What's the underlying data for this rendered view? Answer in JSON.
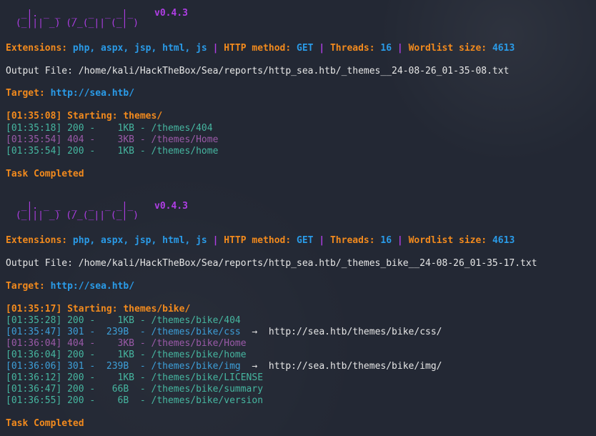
{
  "runs": [
    {
      "logo": "  _|. _ _  _  _  _ _|_\n (_||| _) (/_(_|| (_| )",
      "version": "v0.4.3",
      "config": {
        "extensions_label": "Extensions:",
        "extensions": "php, aspx, jsp, html, js",
        "sep": "|",
        "method_label": "HTTP method:",
        "method": "GET",
        "threads_label": "Threads:",
        "threads": "16",
        "wordlist_label": "Wordlist size:",
        "wordlist": "4613"
      },
      "output_file": "Output File: /home/kali/HackTheBox/Sea/reports/http_sea.htb/_themes__24-08-26_01-35-08.txt",
      "target_label": "Target:",
      "target": "http://sea.htb/",
      "starting": "[01:35:08] Starting: themes/",
      "results": [
        {
          "text": "[01:35:18] 200 -    1KB - /themes/404",
          "kind": "ok",
          "redirect": ""
        },
        {
          "text": "[01:35:54] 404 -    3KB - /themes/Home",
          "kind": "notfound",
          "redirect": ""
        },
        {
          "text": "[01:35:54] 200 -    1KB - /themes/home",
          "kind": "ok",
          "redirect": ""
        }
      ],
      "completed": "Task Completed"
    },
    {
      "logo": "  _|. _ _  _  _  _ _|_\n (_||| _) (/_(_|| (_| )",
      "version": "v0.4.3",
      "config": {
        "extensions_label": "Extensions:",
        "extensions": "php, aspx, jsp, html, js",
        "sep": "|",
        "method_label": "HTTP method:",
        "method": "GET",
        "threads_label": "Threads:",
        "threads": "16",
        "wordlist_label": "Wordlist size:",
        "wordlist": "4613"
      },
      "output_file": "Output File: /home/kali/HackTheBox/Sea/reports/http_sea.htb/_themes_bike__24-08-26_01-35-17.txt",
      "target_label": "Target:",
      "target": "http://sea.htb/",
      "starting": "[01:35:17] Starting: themes/bike/",
      "results": [
        {
          "text": "[01:35:28] 200 -    1KB - /themes/bike/404",
          "kind": "ok",
          "redirect": ""
        },
        {
          "text": "[01:35:47] 301 -  239B  - /themes/bike/css",
          "kind": "redirect",
          "redirect": "http://sea.htb/themes/bike/css/"
        },
        {
          "text": "[01:36:04] 404 -    3KB - /themes/bike/Home",
          "kind": "notfound",
          "redirect": ""
        },
        {
          "text": "[01:36:04] 200 -    1KB - /themes/bike/home",
          "kind": "ok",
          "redirect": ""
        },
        {
          "text": "[01:36:06] 301 -  239B  - /themes/bike/img",
          "kind": "redirect",
          "redirect": "http://sea.htb/themes/bike/img/"
        },
        {
          "text": "[01:36:12] 200 -    1KB - /themes/bike/LICENSE",
          "kind": "ok",
          "redirect": ""
        },
        {
          "text": "[01:36:47] 200 -   66B  - /themes/bike/summary",
          "kind": "ok",
          "redirect": ""
        },
        {
          "text": "[01:36:55] 200 -    6B  - /themes/bike/version",
          "kind": "ok",
          "redirect": ""
        }
      ],
      "completed": "Task Completed"
    }
  ],
  "arrow": "→",
  "colors": {
    "background": "#232834",
    "logo": "#b03ee6",
    "label": "#f28a1d",
    "value": "#2a9be8",
    "ok": "#46b6a0",
    "notfound": "#9a5aa8",
    "redirect": "#3d9fd8"
  }
}
